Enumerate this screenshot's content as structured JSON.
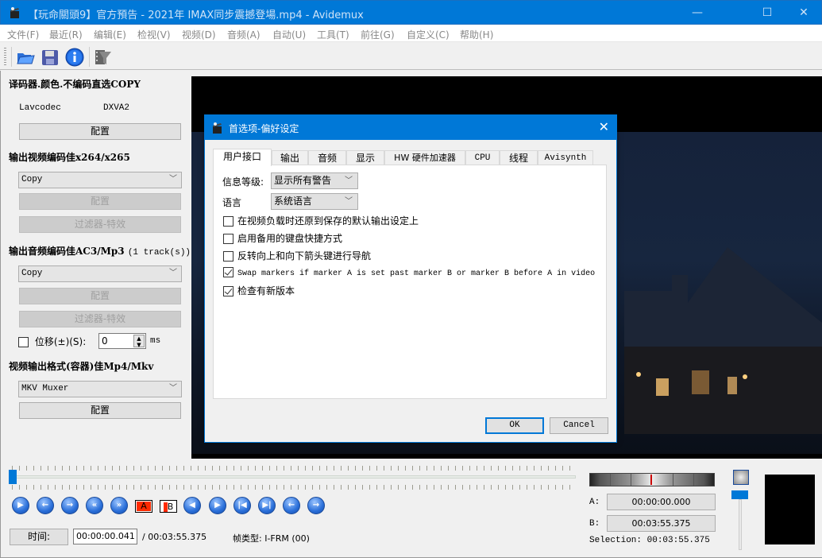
{
  "window": {
    "title": "【玩命關頭9】官方預告 - 2021年 IMAX同步震撼登場.mp4 - Avidemux",
    "app_icon": "clapperboard-icon",
    "controls": {
      "minimize": "—",
      "maximize": "☐",
      "close": "✕"
    }
  },
  "menu": [
    "文件(F)",
    "最近(R)",
    "编辑(E)",
    "检视(V)",
    "视频(D)",
    "音频(A)",
    "自动(U)",
    "工具(T)",
    "前往(G)",
    "自定义(C)",
    "帮助(H)"
  ],
  "toolbar": {
    "buttons": [
      {
        "name": "open",
        "icon": "folder-open-icon"
      },
      {
        "name": "save",
        "icon": "floppy-disk-icon"
      },
      {
        "name": "info",
        "icon": "info-icon"
      },
      {
        "name": "filter",
        "icon": "film-filter-icon"
      }
    ]
  },
  "left": {
    "decoder": {
      "heading": "译码器.颜色.不编码直选COPY",
      "codec": "Lavcodec",
      "hw": "DXVA2",
      "config": "配置"
    },
    "video_out": {
      "heading": "输出视频编码佳x264/x265",
      "selected": "Copy",
      "config": "配置",
      "filters": "过滤器-特效"
    },
    "audio_out": {
      "heading": "输出音频编码佳AC3/Mp3",
      "tracks": "(1 track(s))",
      "selected": "Copy",
      "config": "配置",
      "filters": "过滤器-特效",
      "shift_label": "位移(±)(S):",
      "shift_checked": false,
      "shift_value": "0",
      "shift_unit": "ms"
    },
    "format": {
      "heading": "视频输出格式(容器)佳Mp4/Mkv",
      "selected": "MKV Muxer",
      "config": "配置"
    }
  },
  "dialog": {
    "title": "首选项-偏好设定",
    "tabs": [
      "用户接口",
      "输出",
      "音频",
      "显示",
      "HW 硬件加速器",
      "CPU",
      "线程",
      "Avisynth"
    ],
    "active_tab": 0,
    "message_level_label": "信息等级:",
    "message_level_value": "显示所有警告",
    "language_label": "语言",
    "language_value": "系统语言",
    "checkboxes": [
      {
        "label": "在视频负载时还原到保存的默认输出设定上",
        "checked": false
      },
      {
        "label": "启用备用的键盘快捷方式",
        "checked": false
      },
      {
        "label": "反转向上和向下箭头键进行导航",
        "checked": false
      },
      {
        "label": "Swap markers if marker A is set past marker B or marker B before A in video",
        "checked": true
      },
      {
        "label": "检查有新版本",
        "checked": true
      }
    ],
    "ok": "OK",
    "cancel": "Cancel"
  },
  "playback": {
    "position_fraction": 0.0002,
    "buttons": [
      "play",
      "prev-frame",
      "next-frame",
      "prev-keyframe",
      "next-keyframe",
      "marker-a",
      "marker-b",
      "go-marker-a",
      "go-marker-b",
      "go-start",
      "go-end",
      "back-60",
      "forward-60"
    ],
    "marker_a_label": "A",
    "marker_b_label": "B",
    "time_button": "时间:",
    "current_time": "00:00:00.041",
    "total_time": "/ 00:03:55.375",
    "frame_type": "帧类型: I-FRM (00)",
    "a_label": "A:",
    "a_time": "00:00:00.000",
    "b_label": "B:",
    "b_time": "00:03:55.375",
    "selection": "Selection: 00:03:55.375",
    "volume_fraction": 1.0
  }
}
